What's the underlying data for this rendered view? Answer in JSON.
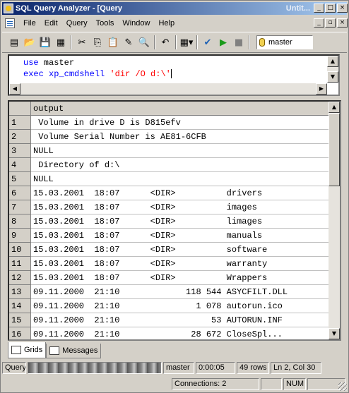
{
  "window": {
    "title": "SQL Query Analyzer - [Query",
    "title_right": "Untit...",
    "buttons": {
      "minimize": "_",
      "maximize": "□",
      "close": "×"
    }
  },
  "menu": [
    "File",
    "Edit",
    "Query",
    "Tools",
    "Window",
    "Help"
  ],
  "mdi_buttons": {
    "minimize": "_",
    "restore": "▫",
    "close": "×"
  },
  "toolbar": {
    "database": "master",
    "icons": [
      "new-query-icon",
      "open-icon",
      "save-icon",
      "load-script-icon",
      "cut-icon",
      "copy-icon",
      "paste-icon",
      "clear-icon",
      "find-icon",
      "undo-icon",
      "results-mode-icon",
      "parse-icon",
      "execute-icon",
      "cancel-icon",
      "database-icon"
    ]
  },
  "editor": {
    "line1": {
      "keyword": "use",
      "text": " master"
    },
    "line2": {
      "keyword": "exec",
      "text": " xp_cmdshell ",
      "string": "'dir /O d:\\'"
    }
  },
  "grid": {
    "column_header": "output",
    "rows": [
      {
        "n": "1",
        "output": " Volume in drive D is D815efv"
      },
      {
        "n": "2",
        "output": " Volume Serial Number is AE81-6CFB"
      },
      {
        "n": "3",
        "output": "NULL"
      },
      {
        "n": "4",
        "output": " Directory of d:\\"
      },
      {
        "n": "5",
        "output": "NULL"
      },
      {
        "n": "6",
        "output": "15.03.2001  18:07      <DIR>          drivers"
      },
      {
        "n": "7",
        "output": "15.03.2001  18:07      <DIR>          images"
      },
      {
        "n": "8",
        "output": "15.03.2001  18:07      <DIR>          limages"
      },
      {
        "n": "9",
        "output": "15.03.2001  18:07      <DIR>          manuals"
      },
      {
        "n": "10",
        "output": "15.03.2001  18:07      <DIR>          software"
      },
      {
        "n": "11",
        "output": "15.03.2001  18:07      <DIR>          warranty"
      },
      {
        "n": "12",
        "output": "15.03.2001  18:07      <DIR>          Wrappers"
      },
      {
        "n": "13",
        "output": "09.11.2000  21:10             118 544 ASYCFILT.DLL"
      },
      {
        "n": "14",
        "output": "09.11.2000  21:10               1 078 autorun.ico"
      },
      {
        "n": "15",
        "output": "09.11.2000  21:10                  53 AUTORUN.INF"
      },
      {
        "n": "16",
        "output": "09.11.2000  21:10              28 672 CloseSpl..."
      }
    ]
  },
  "tabs": [
    {
      "label": "Grids",
      "active": true
    },
    {
      "label": "Messages",
      "active": false
    }
  ],
  "status": {
    "mode": "Query",
    "database": "master",
    "elapsed": "0:00:05",
    "rows": "49 rows",
    "position": "Ln 2, Col 30",
    "connections": "Connections: 2",
    "num": "NUM"
  }
}
